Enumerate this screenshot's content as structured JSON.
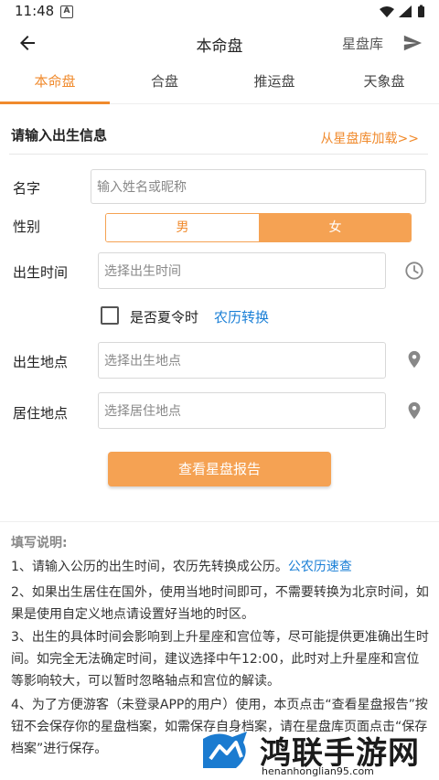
{
  "statusbar": {
    "time": "11:48",
    "notif_icon": "A"
  },
  "appbar": {
    "title": "本命盘",
    "library": "星盘库"
  },
  "tabs": [
    {
      "label": "本命盘",
      "active": true
    },
    {
      "label": "合盘",
      "active": false
    },
    {
      "label": "推运盘",
      "active": false
    },
    {
      "label": "天象盘",
      "active": false
    }
  ],
  "form": {
    "section_title": "请输入出生信息",
    "load_link": "从星盘库加载>>",
    "name_label": "名字",
    "name_placeholder": "输入姓名或昵称",
    "gender_label": "性别",
    "gender_male": "男",
    "gender_female": "女",
    "gender_selected": "女",
    "birth_time_label": "出生时间",
    "birth_time_placeholder": "选择出生时间",
    "dst_label": "是否夏令时",
    "dst_checked": false,
    "lunar_link": "农历转换",
    "birth_place_label": "出生地点",
    "birth_place_placeholder": "选择出生地点",
    "residence_label": "居住地点",
    "residence_placeholder": "选择居住地点",
    "submit": "查看星盘报告"
  },
  "notes": {
    "title": "填写说明:",
    "n1_text": "1、请输入公历的出生时间，农历先转换成公历。",
    "n1_link": "公农历速查",
    "n2": "2、如果出生居住在国外，使用当地时间即可，不需要转换为北京时间，如果是使用自定义地点请设置好当地的时区。",
    "n3": "3、出生的具体时间会影响到上升星座和宫位等，尽可能提供更准确出生时间。如完全无法确定时间，建议选择中午12:00，此时对上升星座和宫位等影响较大，可以暂时忽略轴点和宫位的解读。",
    "n4": "4、为了方便游客（未登录APP的用户）使用，本页点击“查看星盘报告”按钮不会保存你的星盘档案，如需保存自身档案，请在星盘库页面点击“保存档案”进行保存。"
  },
  "watermark": {
    "name": "鸿联手游网",
    "url": "henanhonglian95.com"
  },
  "colors": {
    "accent": "#f08a2c",
    "accent_light": "#f5a253",
    "link": "#1a7fd6"
  }
}
